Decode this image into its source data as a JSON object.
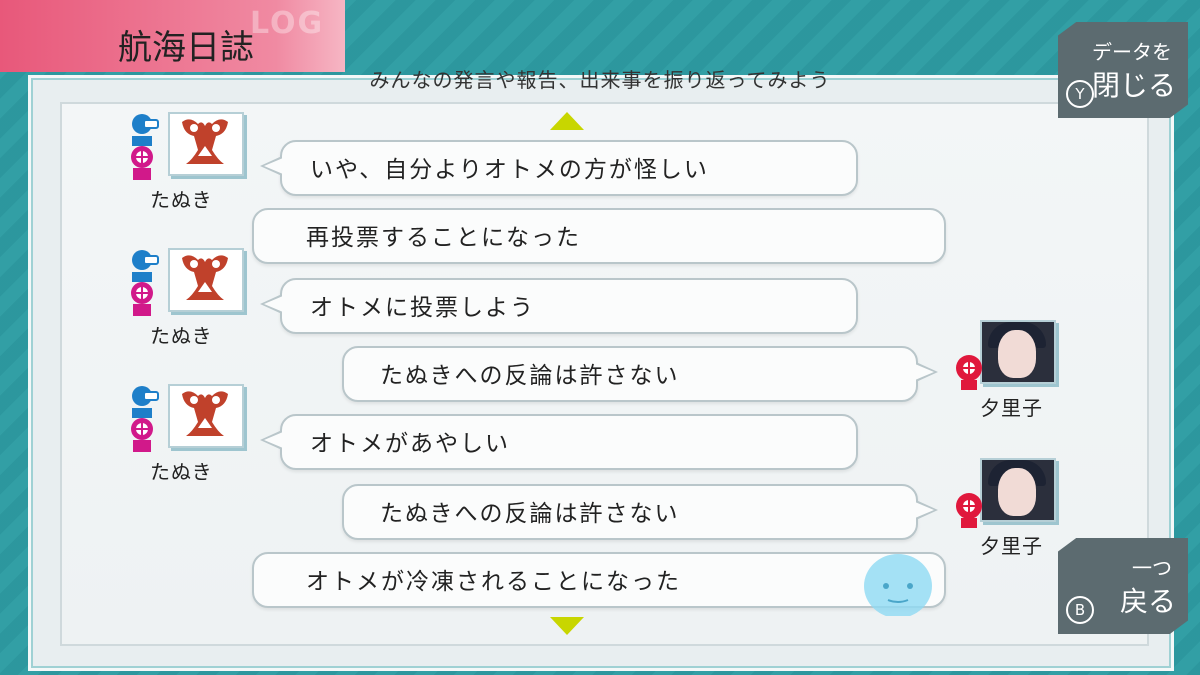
{
  "window": {
    "title": "航海日誌",
    "logo_text": "LOG",
    "subtitle": "みんなの発言や報告、出来事を振り返ってみよう"
  },
  "buttons": {
    "close": {
      "line1": "データを",
      "line2": "閉じる",
      "key": "Y"
    },
    "back": {
      "line1": "一つ",
      "line2": "戻る",
      "key": "B"
    }
  },
  "log": [
    {
      "speaker": "たぬき",
      "text": "いや、自分よりオトメの方が怪しい"
    },
    {
      "speaker": "",
      "text": "再投票することになった"
    },
    {
      "speaker": "たぬき",
      "text": "オトメに投票しよう"
    },
    {
      "speaker": "夕里子",
      "text": "たぬきへの反論は許さない"
    },
    {
      "speaker": "たぬき",
      "text": "オトメがあやしい"
    },
    {
      "speaker": "夕里子",
      "text": "たぬきへの反論は許さない"
    },
    {
      "speaker": "",
      "text": "オトメが冷凍されることになった"
    }
  ],
  "colors": {
    "accent_pink": "#e8587a",
    "arrow": "#c8d600",
    "teal": "#2f9aa0",
    "role_blue": "#1e7fc9",
    "role_magenta": "#d1198a",
    "role_red": "#e0183c"
  },
  "icons": [
    "arrow-up-icon",
    "arrow-down-icon",
    "tanuki-emblem-icon",
    "role-engineer-icon",
    "role-guard-icon",
    "skull-icon",
    "ghost-icon"
  ]
}
